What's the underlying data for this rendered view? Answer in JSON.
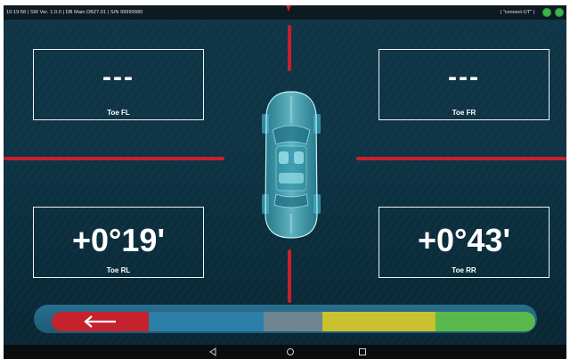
{
  "status_bar": {
    "info": "10:19:58  |  SW Ver. 1.0.0  |  DB Main DB27.01  |  S/N 99999980",
    "connection": "|  \"connect-UT\"  |"
  },
  "readings": {
    "toe_fl": {
      "value": "---",
      "label": "Toe FL"
    },
    "toe_fr": {
      "value": "---",
      "label": "Toe FR"
    },
    "toe_rl": {
      "value": "+0°19'",
      "label": "Toe RL"
    },
    "toe_rr": {
      "value": "+0°43'",
      "label": "Toe RR"
    }
  },
  "colors": {
    "marker_red": "#c8202a",
    "status_green": "#39b54a",
    "segment_red": "#c4232e",
    "segment_blue": "#2c7fa8",
    "segment_gray": "#6d8692",
    "segment_yellow": "#c9c130",
    "segment_green": "#5ab94c"
  },
  "icons": {
    "back": "left-arrow-icon",
    "nav_back": "triangle-back-icon",
    "nav_home": "circle-home-icon",
    "nav_recents": "square-recents-icon"
  }
}
